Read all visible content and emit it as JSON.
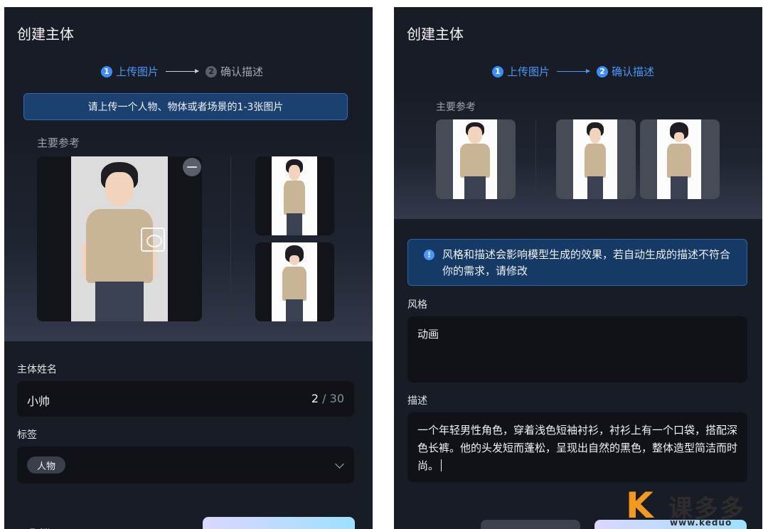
{
  "left_panel": {
    "title": "创建主体",
    "steps": [
      {
        "num": "1",
        "label": "上传图片",
        "state": "active"
      },
      {
        "num": "2",
        "label": "确认描述",
        "state": "inactive"
      }
    ],
    "upload_hint": "请上传一个人物、物体或者场景的1-3张图片",
    "main_ref_label": "主要参考",
    "name_label": "主体姓名",
    "name_value": "小帅",
    "name_count": "2",
    "name_max": "/ 30",
    "tag_label": "标签",
    "tag_value": "人物",
    "bottom_left_text": "取消"
  },
  "right_panel": {
    "title": "创建主体",
    "steps": [
      {
        "num": "1",
        "label": "上传图片",
        "state": "active"
      },
      {
        "num": "2",
        "label": "确认描述",
        "state": "active"
      }
    ],
    "main_ref_label": "主要参考",
    "info_text": "风格和描述会影响模型生成的效果，若自动生成的描述不符合你的需求，请修改",
    "style_label": "风格",
    "style_value": "动画",
    "desc_label": "描述",
    "desc_value": "一个年轻男性角色，穿着浅色短袖衬衫，衬衫上有一个口袋，搭配深色长裤。他的头发短而蓬松，呈现出自然的黑色，整体造型简洁而时尚。"
  },
  "watermark": {
    "logo": "K",
    "text": "课多多",
    "url": "www.keduo"
  },
  "colors": {
    "accent": "#3b8cff",
    "panel_bg": "#181c24",
    "input_bg": "#0f1217",
    "hint_bg": "#1b4170"
  }
}
